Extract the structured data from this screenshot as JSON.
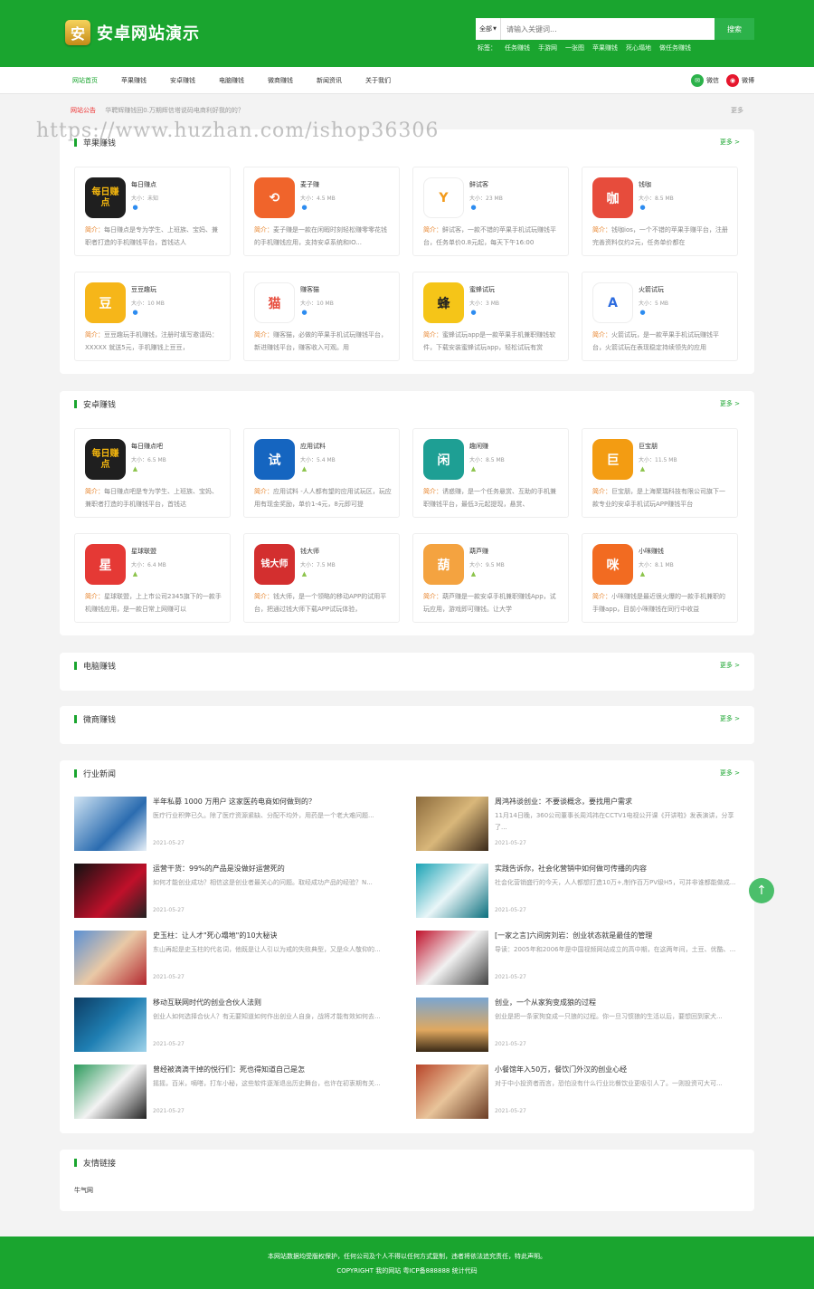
{
  "header": {
    "logo_badge": "安",
    "site_title": "安卓网站演示",
    "search": {
      "select_value": "全部",
      "placeholder": "请输入关键词...",
      "button": "搜索"
    },
    "tags_label": "标签：",
    "tags": [
      "任务赚钱",
      "手游网",
      "一张图",
      "苹果赚钱",
      "死心塌地",
      "做任务赚钱"
    ]
  },
  "nav": {
    "items": [
      "网站首页",
      "苹果赚钱",
      "安卓赚钱",
      "电脑赚钱",
      "微商赚钱",
      "新闻资讯",
      "关于我们"
    ],
    "wechat": "微信",
    "weibo": "微博"
  },
  "notice": {
    "label": "网站公告",
    "text": "华聘辉赚钱回0.万期辉信塔说码电商利好我的的？",
    "more": "更多"
  },
  "watermark": "https://www.huzhan.com/ishop36306",
  "more_label": "更多 >",
  "intro_label": "简介：",
  "sections": {
    "apple": {
      "title": "苹果赚钱",
      "apps": [
        {
          "name": "每日赚点",
          "size": "大小：未知",
          "desc": "每日赚点是专为学生、上班族、宝妈、兼职者打造的手机赚钱平台，首钱达人",
          "icon": "每日赚点",
          "bg": "#1f1f1f",
          "fg": "#f5b70e"
        },
        {
          "name": "麦子赚",
          "size": "大小：4.5 MB",
          "desc": "麦子赚是一款在闲暇时刻轻松赚零零花钱的手机赚钱应用，支持安卓系统和IO...",
          "icon": "⟲",
          "bg": "#f0642b",
          "fg": "#ffffff"
        },
        {
          "name": "鲜试客",
          "size": "大小：23 MB",
          "desc": "鲜试客，一款不错的苹果手机试玩赚钱平台，任务单价0.8元起，每天下午16:00",
          "icon": "Y",
          "bg": "#ffffff",
          "fg": "#f29a1b"
        },
        {
          "name": "钱咖",
          "size": "大小：8.5 MB",
          "desc": "钱咖ios，一个不错的苹果手赚平台，注册完善资料仅约2元，任务单价都在",
          "icon": "咖",
          "bg": "#e74c3c",
          "fg": "#ffffff"
        },
        {
          "name": "豆豆趣玩",
          "size": "大小：10 MB",
          "desc": "豆豆趣玩手机赚钱，注册时填写邀请码：XXXXX 就送5元，手机赚钱上豆豆，",
          "icon": "豆",
          "bg": "#f6b619",
          "fg": "#ffffff"
        },
        {
          "name": "赚客猫",
          "size": "大小：10 MB",
          "desc": "赚客猫，必做的苹果手机试玩赚钱平台，新进赚钱平台，赚客收入可观。用",
          "icon": "猫",
          "bg": "#ffffff",
          "fg": "#e74c3c"
        },
        {
          "name": "蜜蜂试玩",
          "size": "大小：3 MB",
          "desc": "蜜蜂试玩app是一款苹果手机兼职赚钱软件，下载安装蜜蜂试玩app，轻松试玩有赏",
          "icon": "蜂",
          "bg": "#f5c518",
          "fg": "#222222"
        },
        {
          "name": "火箭试玩",
          "size": "大小：5 MB",
          "desc": "火箭试玩，是一款苹果手机试玩赚钱平台，火箭试玩在表现稳定持续领先的应用",
          "icon": "A",
          "bg": "#ffffff",
          "fg": "#2d6cdf"
        }
      ]
    },
    "android": {
      "title": "安卓赚钱",
      "apps": [
        {
          "name": "每日赚点吧",
          "size": "大小：6.5 MB",
          "desc": "每日赚点吧是专为学生、上班族、宝妈、兼职者打造的手机赚钱平台，首钱达",
          "icon": "每日赚点",
          "bg": "#1f1f1f",
          "fg": "#f5b70e"
        },
        {
          "name": "应用试料",
          "size": "大小：5.4 MB",
          "desc": "应用试料 -人人都有望的应用试玩区，玩应用有现金奖励，单价1-4元，8元即可提",
          "icon": "试",
          "bg": "#1565c0",
          "fg": "#ffffff"
        },
        {
          "name": "趣闲赚",
          "size": "大小：8.5 MB",
          "desc": "诱惑赚，是一个任务悬赏、互助的手机兼职赚钱平台，最低3元起提现，悬赏、",
          "icon": "闲",
          "bg": "#1e9f94",
          "fg": "#ffffff"
        },
        {
          "name": "巨宝朋",
          "size": "大小：11.5 MB",
          "desc": "巨宝朋，是上海聚瑞科技有限公司旗下一款专业的安卓手机试玩APP赚钱平台",
          "icon": "巨",
          "bg": "#f39c12",
          "fg": "#ffffff"
        },
        {
          "name": "星球联盟",
          "size": "大小：6.4 MB",
          "desc": "星球联盟，上上市公司2345旗下的一款手机赚钱应用，是一款日常上网赚可以",
          "icon": "星",
          "bg": "#e53935",
          "fg": "#ffffff"
        },
        {
          "name": "钱大师",
          "size": "大小：7.5 MB",
          "desc": "钱大师，是一个领略的移动APP的试用平台，把通过钱大师下载APP试玩体验，",
          "icon": "钱大师",
          "bg": "#d32f2f",
          "fg": "#ffffff"
        },
        {
          "name": "葫芦赚",
          "size": "大小：9.5 MB",
          "desc": "葫芦赚是一款安卓手机兼职赚钱App，试玩应用，游戏即可赚钱。让大学",
          "icon": "葫",
          "bg": "#f4a340",
          "fg": "#ffffff"
        },
        {
          "name": "小咪赚钱",
          "size": "大小：8.1 MB",
          "desc": "小咪赚钱是最近很火爆的一款手机兼职的手赚app，目前小咪赚钱在同行中收益",
          "icon": "咪",
          "bg": "#f26b21",
          "fg": "#ffffff"
        }
      ]
    },
    "pc": {
      "title": "电脑赚钱"
    },
    "wechat": {
      "title": "微商赚钱"
    },
    "news": {
      "title": "行业新闻",
      "items": [
        {
          "title": "半年私募 1000 万用户 这家医药电商如何做到的？",
          "desc": "医疗行业积弊已久。除了医疗资源紧缺、分配不均外，用药是一个老大难问题...",
          "date": "2021-05-27"
        },
        {
          "title": "周鸿祎谈创业：不要谈概念，要找用户需求",
          "desc": "11月14日晚，360公司董事长周鸿祎在CCTV1电视公开课《开讲啦》发表演讲，分享了...",
          "date": "2021-05-27"
        },
        {
          "title": "运营干货：99%的产品是没做好运营死的",
          "desc": "如何才能创业成功？相信这是创业者最关心的问题。取经成功产品的经验？N...",
          "date": "2021-05-27"
        },
        {
          "title": "实践告诉你，社会化营销中如何做可传播的内容",
          "desc": "社会化营销盛行的今天，人人都想打造10万+,制作百万PV级H5，可并非谁都能做成...",
          "date": "2021-05-27"
        },
        {
          "title": "史玉柱：让人才\"死心塌地\"的10大秘诀",
          "desc": "东山再起是史玉柱的代名词，他既是让人引以为戒的失败典型，又是众人敬仰的...",
          "date": "2021-05-27"
        },
        {
          "title": "[一家之言]六间房刘岩：创业状态就是最佳的管理",
          "desc": "导读：2005年和2006年是中国视频网站成立的高中期，在这两年间，土豆、优酷、...",
          "date": "2021-05-27"
        },
        {
          "title": "移动互联网时代的创业合伙人法则",
          "desc": "创业人如何选择合伙人？有无要知道如何作出创业人自身，战将才能有效如何去...",
          "date": "2021-05-27"
        },
        {
          "title": "创业，一个从家狗变成狼的过程",
          "desc": "创业是把一条家狗变成一只狼的过程。你一旦习惯狼的生活以后，要想回到家犬...",
          "date": "2021-05-27"
        },
        {
          "title": "曾经被滴滴干掉的悦行们：死也得知道自己是怎",
          "desc": "摇摇，百米，嘀嗒，打车小秘，这些软件逐渐退出历史舞台，也许在初衷期有关...",
          "date": "2021-05-27"
        },
        {
          "title": "小餐馆年入50万，餐饮门外汉的创业心经",
          "desc": "对于中小投资者而言，恐怕没有什么行业比餐饮业更吸引人了。一则投资可大可...",
          "date": "2021-05-27"
        }
      ]
    },
    "links": {
      "title": "友情链接",
      "items": [
        "牛气网"
      ]
    }
  },
  "footer": {
    "line1": "本网站数据均受版权保护，任何公司及个人不得以任何方式复制，违者将依法追究责任，特此声明。",
    "line2": "COPYRIGHT 我的网站 粤ICP备888888 统计代码"
  },
  "to_top": "↑"
}
